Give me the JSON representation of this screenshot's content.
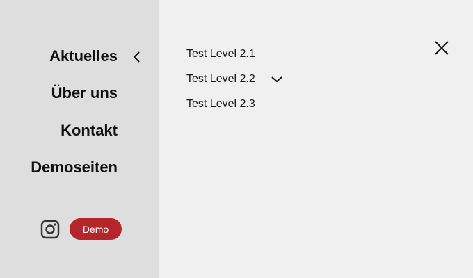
{
  "nav": {
    "items": [
      {
        "label": "Aktuelles"
      },
      {
        "label": "Über uns"
      },
      {
        "label": "Kontakt"
      },
      {
        "label": "Demoseiten"
      }
    ]
  },
  "submenu": {
    "items": [
      {
        "label": "Test Level 2.1"
      },
      {
        "label": "Test Level 2.2"
      },
      {
        "label": "Test Level 2.3"
      }
    ]
  },
  "social": {
    "icon": "instagram-icon",
    "badge_label": "Demo",
    "badge_color": "#b5262b"
  },
  "colors": {
    "sidebar_bg": "#dedede",
    "panel_bg": "#f0f0f0",
    "text": "#111111"
  }
}
